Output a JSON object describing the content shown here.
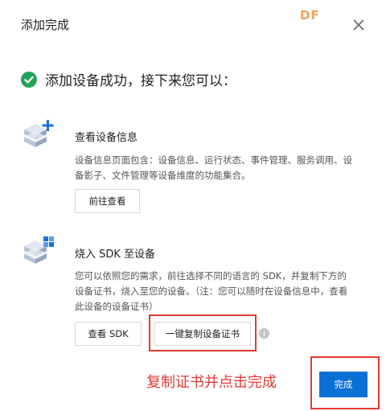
{
  "dialog": {
    "title": "添加完成",
    "watermark": "DF"
  },
  "success": {
    "text": "添加设备成功，接下来您可以："
  },
  "section1": {
    "title": "查看设备信息",
    "desc_line1": "设备信息页面包含：设备信息、运行状态、事件管理、服务调用、设",
    "desc_line2": "备影子、文件管理等设备维度的功能集合。",
    "button": "前往查看"
  },
  "section2": {
    "title": "烧入 SDK 至设备",
    "desc_line1": "您可以依照您的需求，前往选择不同的语言的 SDK，并复制下方的",
    "desc_line2": "设备证书，烧入至您的设备。（注：您可以随时在设备信息中，查看",
    "desc_line3": "此设备的设备证书）",
    "button_sdk": "查看 SDK",
    "button_copy": "一键复制设备证书"
  },
  "annotation": "复制证书并点击完成",
  "footer": {
    "done_button": "完成"
  },
  "colors": {
    "primary": "#0b70d6",
    "success": "#21a35a",
    "annotation": "#e53930",
    "watermark": "#f5a35a"
  }
}
